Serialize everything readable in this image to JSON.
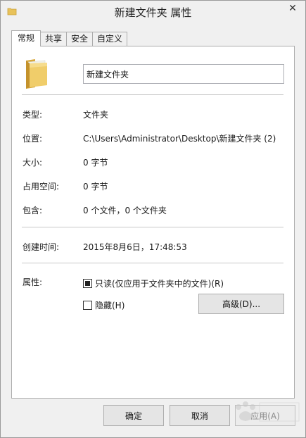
{
  "window": {
    "title": "新建文件夹 属性",
    "close_glyph": "✕"
  },
  "tabs": [
    {
      "label": "常规",
      "active": true
    },
    {
      "label": "共享",
      "active": false
    },
    {
      "label": "安全",
      "active": false
    },
    {
      "label": "自定义",
      "active": false
    }
  ],
  "general": {
    "folder_name": "新建文件夹",
    "type_label": "类型:",
    "type_value": "文件夹",
    "location_label": "位置:",
    "location_value": "C:\\Users\\Administrator\\Desktop\\新建文件夹 (2)",
    "size_label": "大小:",
    "size_value": "0 字节",
    "size_on_disk_label": "占用空间:",
    "size_on_disk_value": "0 字节",
    "contains_label": "包含:",
    "contains_value": "0 个文件，0 个文件夹",
    "created_label": "创建时间:",
    "created_value": "2015年8月6日，17:48:53",
    "attributes_label": "属性:",
    "readonly_label": "只读(仅应用于文件夹中的文件)(R)",
    "readonly_state": "indeterminate",
    "hidden_label": "隐藏(H)",
    "hidden_state": "unchecked",
    "advanced_button": "高级(D)..."
  },
  "buttons": {
    "ok": "确定",
    "cancel": "取消",
    "apply": "应用(A)"
  },
  "colors": {
    "folder": "#e8c25a",
    "panel": "#ffffff",
    "window": "#f0f0f0"
  }
}
